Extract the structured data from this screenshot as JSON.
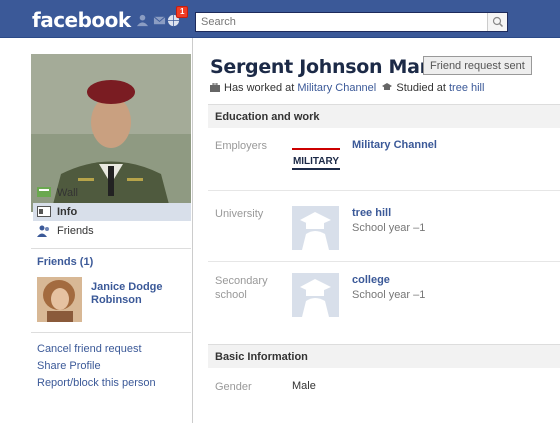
{
  "topbar": {
    "logo": "facebook",
    "notification_count": "1",
    "search_placeholder": "Search",
    "color": "#3b5998"
  },
  "left": {
    "nav": [
      {
        "label": "Wall",
        "icon": "wall-icon"
      },
      {
        "label": "Info",
        "icon": "info-icon"
      },
      {
        "label": "Friends",
        "icon": "friends-icon"
      }
    ],
    "friends_title": "Friends (1)",
    "friend_name": "Janice Dodge Robinson",
    "links": [
      "Cancel friend request",
      "Share Profile",
      "Report/block this person"
    ]
  },
  "profile": {
    "name": "Sergent Johnson Mark",
    "friend_request_button": "Friend request sent",
    "worked_prefix": "Has worked at",
    "worked_at": "Military Channel",
    "studied_prefix": "Studied at",
    "studied_at": "tree hill"
  },
  "education": {
    "heading": "Education and work",
    "employers_label": "Employers",
    "employer": "Military Channel",
    "employer_logo_text": "MILITARY",
    "university_label": "University",
    "university": "tree hill",
    "university_year": "School year –1",
    "secondary_label": "Secondary school",
    "secondary": "college",
    "secondary_year": "School year –1"
  },
  "basic": {
    "heading": "Basic Information",
    "gender_label": "Gender",
    "gender": "Male"
  }
}
